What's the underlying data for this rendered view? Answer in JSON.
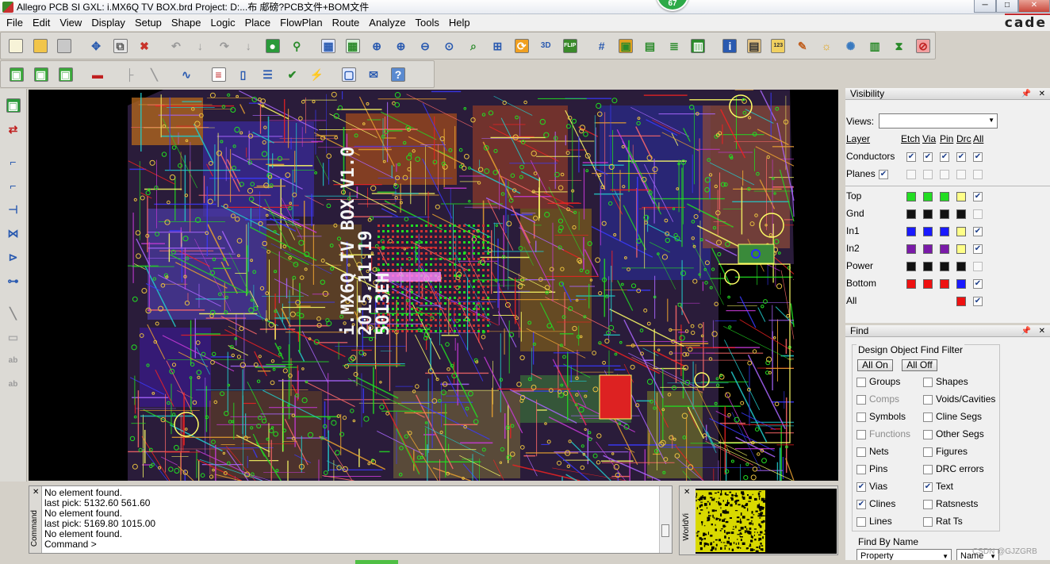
{
  "window": {
    "title": "Allegro PCB SI GXL: i.MX6Q TV BOX.brd  Project: D:...布    郕磅?PCB文件+BOM文件",
    "badge": "67",
    "controls": [
      "─",
      "□",
      "✕"
    ]
  },
  "menu": {
    "items": [
      "File",
      "Edit",
      "View",
      "Display",
      "Setup",
      "Shape",
      "Logic",
      "Place",
      "FlowPlan",
      "Route",
      "Analyze",
      "Tools",
      "Help"
    ],
    "logo": "cade"
  },
  "toolbar_row1": {
    "icons": [
      "new-icon",
      "open-icon",
      "save-icon",
      "move-icon",
      "copy-icon",
      "delete-icon",
      "undo-icon",
      "undo-arrow-icon",
      "redo-icon",
      "redo-arrow-icon",
      "snap-icon",
      "pin-icon",
      "grid-icon",
      "zoom-fit-icon",
      "zoom-box-icon",
      "zoom-in-icon",
      "zoom-out-icon",
      "zoom-world-icon",
      "zoom-prev-icon",
      "zoom-center-icon",
      "refresh-icon",
      "3d-icon",
      "flip-icon",
      "grid-toggle-icon",
      "color-icon",
      "layer-icon",
      "stack-icon",
      "chip-icon",
      "info-icon",
      "properties-icon",
      "measure-icon",
      "brush-icon",
      "sun-icon",
      "light-icon",
      "bars-icon",
      "hourglass-icon",
      "drc-icon"
    ],
    "labels": {
      "3d": "3D",
      "flip": "FLIP",
      "measure": "123"
    }
  },
  "toolbar_row2": {
    "icons": [
      "layer-green-1-icon",
      "layer-green-2-icon",
      "layer-green-3-icon",
      "component-icon",
      "line-icon",
      "diagonal-icon",
      "route-icon",
      "doc-icon",
      "book-icon",
      "checklist-icon",
      "check-icon",
      "wand-icon",
      "window-icon",
      "mail-icon",
      "help-icon"
    ]
  },
  "vbar": {
    "icons": [
      "place-icon",
      "swap-icon",
      "connect-icon",
      "bend-icon",
      "slide-icon",
      "spread-icon",
      "delay-tune-icon",
      "phase-tune-icon",
      "add-line-icon",
      "rect-icon",
      "text-icon",
      "text-edit-icon"
    ]
  },
  "console": {
    "side_label": "Command",
    "lines": [
      "No element found.",
      "last pick:  5132.60  561.60",
      "No element found.",
      "last pick:  5169.80  1015.00",
      "No element found.",
      "Command >"
    ]
  },
  "worldview": {
    "side_label": "WorldVi"
  },
  "visibility": {
    "title": "Visibility",
    "views_label": "Views:",
    "columns": [
      "Layer",
      "Etch",
      "Via",
      "Pin",
      "Drc",
      "All"
    ],
    "global_rows": [
      {
        "label": "Conductors",
        "checks": [
          true,
          true,
          true,
          true,
          true
        ],
        "dim": false
      },
      {
        "label": "Planes",
        "inline_check": true,
        "checks": [
          false,
          false,
          false,
          false,
          false
        ],
        "dim": true
      }
    ],
    "layer_rows": [
      {
        "label": "Top",
        "colors": [
          "#22dd22",
          "#22dd22",
          "#22dd22",
          "#ffff88"
        ],
        "all": true
      },
      {
        "label": "Gnd",
        "colors": [
          "#111111",
          "#111111",
          "#111111",
          "#111111"
        ],
        "all": false
      },
      {
        "label": "In1",
        "colors": [
          "#1a1aff",
          "#1a1aff",
          "#1a1aff",
          "#ffff88"
        ],
        "all": true
      },
      {
        "label": "In2",
        "colors": [
          "#7a1aa8",
          "#7a1aa8",
          "#7a1aa8",
          "#ffff88"
        ],
        "all": true
      },
      {
        "label": "Power",
        "colors": [
          "#111111",
          "#111111",
          "#111111",
          "#111111"
        ],
        "all": false
      },
      {
        "label": "Bottom",
        "colors": [
          "#ee1111",
          "#ee1111",
          "#ee1111",
          "#1a1aff"
        ],
        "all": true
      },
      {
        "label": "All",
        "colors": [
          null,
          null,
          null,
          "#ee1111"
        ],
        "all": true
      }
    ]
  },
  "find": {
    "title": "Find",
    "filter_label": "Design Object Find Filter",
    "all_on": "All On",
    "all_off": "All Off",
    "items_left": [
      {
        "label": "Groups",
        "checked": false,
        "dim": false
      },
      {
        "label": "Comps",
        "checked": false,
        "dim": true
      },
      {
        "label": "Symbols",
        "checked": false,
        "dim": false
      },
      {
        "label": "Functions",
        "checked": false,
        "dim": true
      },
      {
        "label": "Nets",
        "checked": false,
        "dim": false
      },
      {
        "label": "Pins",
        "checked": false,
        "dim": false
      },
      {
        "label": "Vias",
        "checked": true,
        "dim": false
      },
      {
        "label": "Clines",
        "checked": true,
        "dim": false
      },
      {
        "label": "Lines",
        "checked": false,
        "dim": false
      }
    ],
    "items_right": [
      {
        "label": "Shapes",
        "checked": false
      },
      {
        "label": "Voids/Cavities",
        "checked": false
      },
      {
        "label": "Cline Segs",
        "checked": false
      },
      {
        "label": "Other Segs",
        "checked": false
      },
      {
        "label": "Figures",
        "checked": false
      },
      {
        "label": "DRC errors",
        "checked": false
      },
      {
        "label": "Text",
        "checked": true
      },
      {
        "label": "Ratsnests",
        "checked": false
      },
      {
        "label": "Rat Ts",
        "checked": false
      }
    ],
    "find_by_name_label": "Find By Name",
    "property_value": "Property",
    "name_value": "Name"
  },
  "canvas": {
    "silkscreen_lines": [
      "i.MX6Q TV BOX V1.0",
      "2015.11.19",
      "5013EH"
    ]
  },
  "watermark": "CSDN @GJZGRB"
}
